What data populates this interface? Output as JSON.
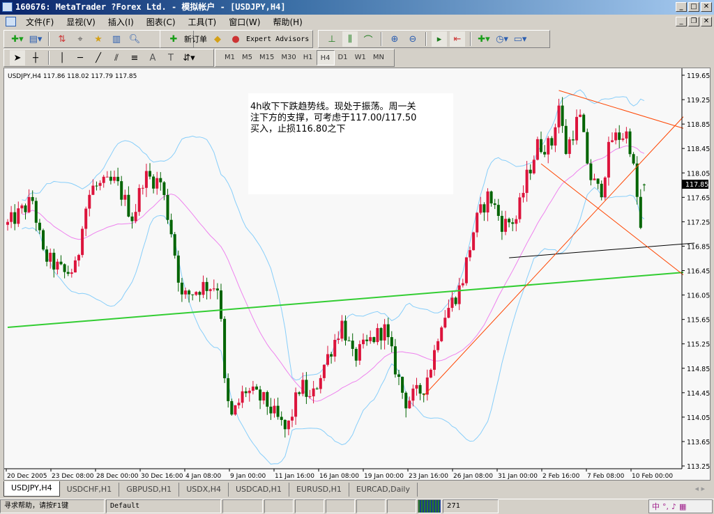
{
  "window": {
    "title": "160676: MetaTrader ?Forex Ltd. - 模拟帐户 - [USDJPY,H4]",
    "minimize": "_",
    "maximize": "□",
    "close": "✕",
    "restore": "❐"
  },
  "menu": [
    "文件(F)",
    "显视(V)",
    "插入(I)",
    "图表(C)",
    "工具(T)",
    "窗口(W)",
    "帮助(H)"
  ],
  "toolbar": {
    "new_order": "新订单",
    "expert_advisors": "Expert Advisors"
  },
  "timeframes": [
    "M1",
    "M5",
    "M15",
    "M30",
    "H1",
    "H4",
    "D1",
    "W1",
    "MN"
  ],
  "active_timeframe": "H4",
  "chart": {
    "header": "USDJPY,H4  117.86 118.02 117.79 117.85",
    "current_price": "117.85",
    "annotation": [
      "4h收下下跌趋势线。现处于振荡。周一关",
      "注下方的支撑，可考虑于117.00/117.50",
      "买入，止损116.80之下"
    ]
  },
  "chart_data": {
    "type": "candlestick",
    "symbol": "USDJPY",
    "timeframe": "H4",
    "ylim": [
      113.25,
      119.65
    ],
    "yticks": [
      "119.65",
      "119.25",
      "118.85",
      "118.45",
      "118.05",
      "117.65",
      "117.25",
      "116.85",
      "116.45",
      "116.05",
      "115.65",
      "115.25",
      "114.85",
      "114.45",
      "114.05",
      "113.65",
      "113.25"
    ],
    "xlabels": [
      "20 Dec 2005",
      "23 Dec 08:00",
      "28 Dec 00:00",
      "30 Dec 16:00",
      "4 Jan 08:00",
      "9 Jan 00:00",
      "11 Jan 16:00",
      "16 Jan 08:00",
      "19 Jan 00:00",
      "23 Jan 16:00",
      "26 Jan 08:00",
      "31 Jan 00:00",
      "2 Feb 16:00",
      "7 Feb 08:00",
      "10 Feb 00:00"
    ],
    "bars": 180,
    "close_path": [
      [
        0,
        117.2
      ],
      [
        7,
        117.6
      ],
      [
        10,
        116.7
      ],
      [
        16,
        116.4
      ],
      [
        19.6,
        116.5
      ],
      [
        20.6,
        117.2
      ],
      [
        23.5,
        117.8
      ],
      [
        30.4,
        117.9
      ],
      [
        35.3,
        117.3
      ],
      [
        38.2,
        118.0
      ],
      [
        43,
        117.9
      ],
      [
        46,
        117.1
      ],
      [
        49,
        116.0
      ],
      [
        55,
        116.2
      ],
      [
        59.8,
        116.2
      ],
      [
        60.4,
        114.8
      ],
      [
        62.7,
        114.0
      ],
      [
        66.7,
        114.5
      ],
      [
        72.5,
        114.3
      ],
      [
        78.4,
        113.8
      ],
      [
        82.4,
        114.6
      ],
      [
        85.3,
        114.3
      ],
      [
        88.2,
        114.8
      ],
      [
        94.1,
        115.6
      ],
      [
        97.1,
        115.0
      ],
      [
        102,
        115.3
      ],
      [
        105.9,
        115.5
      ],
      [
        108.8,
        114.9
      ],
      [
        111.8,
        114.3
      ],
      [
        116.7,
        114.5
      ],
      [
        119.6,
        115.0
      ],
      [
        121.6,
        115.6
      ],
      [
        127.5,
        116.2
      ],
      [
        131.4,
        117.2
      ],
      [
        135.3,
        117.7
      ],
      [
        139.2,
        117.2
      ],
      [
        143.1,
        117.3
      ],
      [
        146.1,
        118.0
      ],
      [
        149,
        118.5
      ],
      [
        152.9,
        118.5
      ],
      [
        154.9,
        119.2
      ],
      [
        156.9,
        118.4
      ],
      [
        160.8,
        119.0
      ],
      [
        163.7,
        118.0
      ],
      [
        166.7,
        117.7
      ],
      [
        169.6,
        118.6
      ],
      [
        174.5,
        118.7
      ],
      [
        176.5,
        117.9
      ],
      [
        178.4,
        116.9
      ],
      [
        179,
        117.85
      ]
    ],
    "last_ohlc": [
      117.86,
      118.02,
      117.79,
      117.85
    ],
    "indicators": [
      {
        "name": "Bollinger Bands",
        "period": 20,
        "deviation": 2,
        "color": "#87cefa"
      },
      {
        "name": "Moving Average",
        "period": 26,
        "color": "#ee82ee"
      }
    ],
    "trendlines": [
      {
        "name": "support-green",
        "color": "#32cd32",
        "from": [
          0,
          115.52
        ],
        "to": [
          190,
          116.42
        ]
      },
      {
        "name": "support-black",
        "color": "#000000",
        "from": [
          141,
          116.66
        ],
        "to": [
          195,
          116.91
        ]
      },
      {
        "name": "channel-top",
        "color": "#ff4500",
        "from": [
          155,
          119.4
        ],
        "to": [
          190,
          118.78
        ]
      },
      {
        "name": "uptrend",
        "color": "#ff4500",
        "from": [
          117,
          114.4
        ],
        "to": [
          190,
          118.97
        ]
      },
      {
        "name": "channel-bottom",
        "color": "#ff4500",
        "from": [
          150,
          118.2
        ],
        "to": [
          190,
          116.38
        ]
      }
    ],
    "up_color": "#dc143c",
    "down_color": "#006400"
  },
  "tabs": [
    "USDJPY,H4",
    "USDCHF,H1",
    "GBPUSD,H1",
    "USDX,H4",
    "USDCAD,H1",
    "EURUSD,H1",
    "EURCAD,Daily"
  ],
  "status": {
    "help": "寻求帮助，请按F1键",
    "profile": "Default",
    "traffic": "271"
  },
  "ime": [
    "中",
    "°,",
    "♪"
  ]
}
